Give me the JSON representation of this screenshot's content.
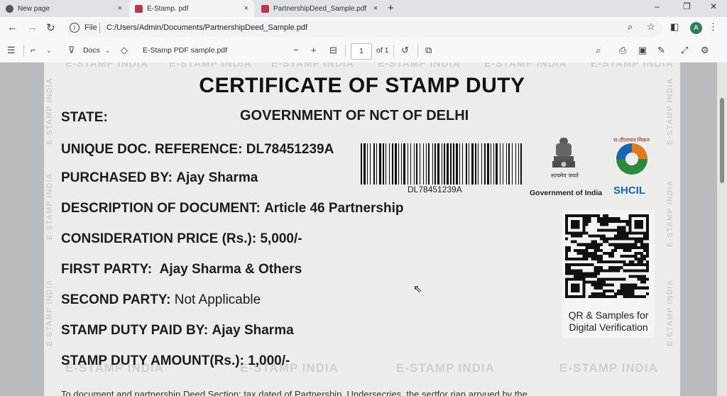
{
  "tabs": [
    {
      "label": "New page",
      "close": "×"
    },
    {
      "label": "E-Stamp. pdf",
      "close": "×"
    },
    {
      "label": "PartnershipDeed_Sample.pdf",
      "close": "×"
    }
  ],
  "new_tab": "+",
  "window_controls": {
    "minimize": "–",
    "restore": "❐",
    "close": "✕"
  },
  "address": {
    "scheme": "File",
    "url": "C:/Users/Admin/Documents/PartnershipDeed_Sample.pdf"
  },
  "profile_initial": "A",
  "pdf_toolbar": {
    "docs_label": "Docs",
    "filename": "E-Stamp PDF sample.pdf",
    "page": "1",
    "page_of": "of 1"
  },
  "certificate": {
    "title": "CERTIFICATE OF STAMP DUTY",
    "state_label": "STATE:",
    "state_value": "GOVERNMENT OF NCT OF DELHI",
    "ref_label": "UNIQUE DOC. REFERENCE:",
    "ref_value": "DL78451239A",
    "purchased_label": "PURCHASED BY:",
    "purchased_value": "Ajay Sharma",
    "desc_label": "DESCRIPTION OF DOCUMENT:",
    "desc_value": "Article 46 Partnership",
    "price_label": "CONSIDERATION PRICE (Rs.):",
    "price_value": "5,000/-",
    "first_label": "FIRST PARTY:",
    "first_value": "Ajay Sharma & Others",
    "second_label": "SECOND PARTY:",
    "second_value": "Not Applicable",
    "paidby_label": "STAMP DUTY PAID BY:",
    "paidby_value": "Ajay Sharma",
    "amount_label": "STAMP DUTY AMOUNT(Rs.):",
    "amount_value": "1,000/-",
    "barcode_text": "DL78451239A",
    "emblem_caption": "Government of India",
    "emblem_motto": "सत्यमेव जयते",
    "shcil_hindi": "स-तीलामन मिकन",
    "shcil_caption": "SHCIL",
    "qr_caption_1": "QR & Samples for",
    "qr_caption_2": "Digital Verification",
    "watermark": "E-STAMP INDIA",
    "bottom_text": "To document and partnership Deed Section: tax dated of Partnership. Undersecries, the sertfor rian arryued by the"
  },
  "colors": {
    "shcil_blue": "#1a64b0",
    "tab_strip": "#dfe3e7",
    "paper": "#ececea"
  }
}
